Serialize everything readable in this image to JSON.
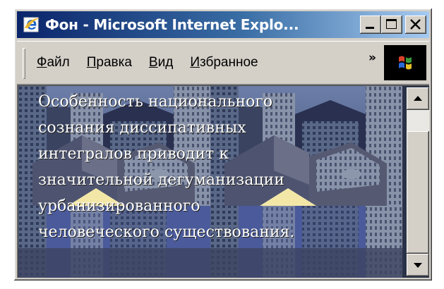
{
  "window": {
    "title": "Фон - Microsoft Internet Explo..."
  },
  "menu": {
    "items": [
      {
        "before": "",
        "accel": "Ф",
        "after": "айл"
      },
      {
        "before": "",
        "accel": "П",
        "after": "равка"
      },
      {
        "before": "",
        "accel": "В",
        "after": "ид"
      },
      {
        "before": "",
        "accel": "И",
        "after": "збранное"
      }
    ],
    "overflow": "»"
  },
  "page": {
    "lines": [
      "Особенность национального",
      "сознания диссипативных",
      "интегралов приводит к",
      "значительной дегуманизации",
      "урбанизированного",
      "человеческого существования."
    ]
  },
  "icons": {
    "app": "internet-explorer-icon",
    "minimize": "minimize-icon",
    "maximize": "maximize-icon",
    "close": "close-icon",
    "throbber": "windows-logo-icon",
    "scroll_up": "arrow-up-icon",
    "scroll_down": "arrow-down-icon"
  }
}
